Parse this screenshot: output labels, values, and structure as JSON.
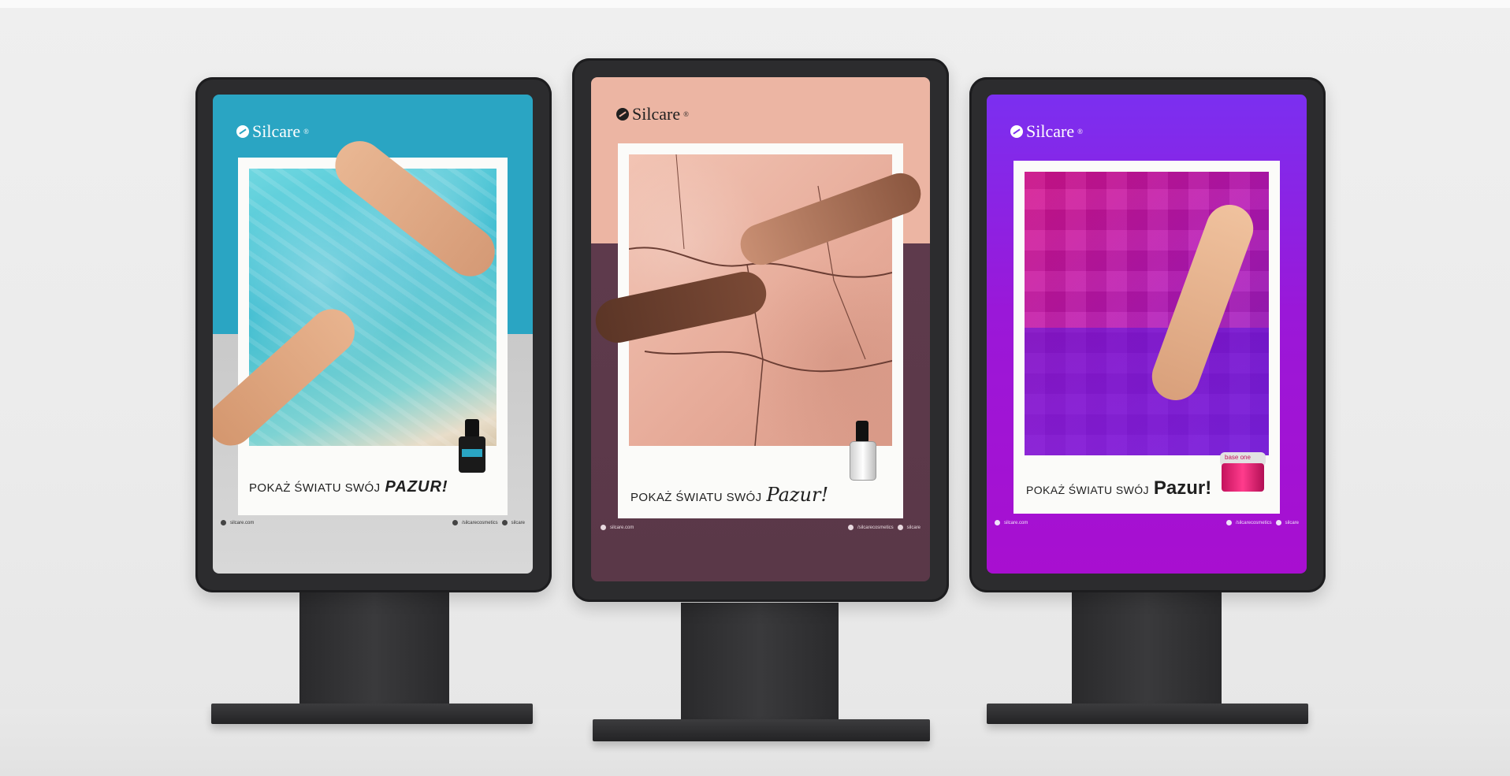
{
  "brand": "Silcare",
  "brand_mark": "®",
  "posters": [
    {
      "theme": "water",
      "tagline_plain": "POKAŻ ŚWIATU SWÓJ",
      "tagline_accent": "PAZUR!",
      "footer_left": "silcare.com",
      "footer_fb": "/silcarecosmetics",
      "footer_ig": "silcare"
    },
    {
      "theme": "cracked-earth",
      "tagline_plain": "POKAŻ ŚWIATU SWÓJ",
      "tagline_accent": "Pazur!",
      "footer_left": "silcare.com",
      "footer_fb": "/silcarecosmetics",
      "footer_ig": "silcare"
    },
    {
      "theme": "pixel-purple",
      "tagline_plain": "POKAŻ ŚWIATU SWÓJ",
      "tagline_accent": "Pazur!",
      "footer_left": "silcare.com",
      "footer_fb": "/silcarecosmetics",
      "footer_ig": "silcare"
    }
  ],
  "product_label": "base one",
  "colors": {
    "poster1_top": "#2aa5c3",
    "poster1_bottom": "#d8d8d8",
    "poster2_top": "#ecb5a3",
    "poster2_bottom": "#5e3a4c",
    "poster3_bg": "#8c12d0",
    "stand_dark": "#2c2c2e"
  },
  "icons": [
    "silcare-logo-icon",
    "facebook-icon",
    "instagram-icon",
    "nail-polish-bottle-icon",
    "gel-jar-icon"
  ]
}
